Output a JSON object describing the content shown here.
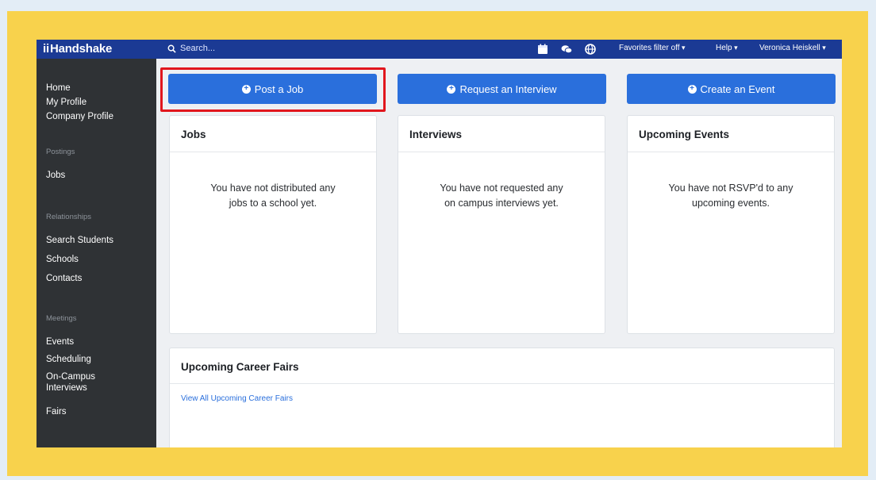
{
  "app": {
    "logo_mark": "ii",
    "logo_text": "Handshake"
  },
  "topbar": {
    "search_placeholder": "Search...",
    "icons": [
      "calendar-icon",
      "chat-icon",
      "globe-icon"
    ],
    "favorites_filter": "Favorites filter off",
    "help": "Help",
    "user": "Veronica Heiskell"
  },
  "sidebar": {
    "items_top": [
      "Home",
      "My Profile",
      "Company Profile"
    ],
    "section_postings": "Postings",
    "item_jobs": "Jobs",
    "section_relationships": "Relationships",
    "relationships": [
      "Search Students",
      "Schools",
      "Contacts"
    ],
    "section_meetings": "Meetings",
    "meetings": [
      "Events",
      "Scheduling",
      "On-Campus Interviews",
      "Fairs"
    ]
  },
  "actions": {
    "post_job": "Post a Job",
    "request_interview": "Request an Interview",
    "create_event": "Create an Event"
  },
  "cards": {
    "jobs": {
      "title": "Jobs",
      "line1": "You have not distributed any",
      "line2": "jobs to a school yet."
    },
    "interviews": {
      "title": "Interviews",
      "line1": "You have not requested any",
      "line2": "on campus interviews yet."
    },
    "events": {
      "title": "Upcoming Events",
      "line1": "You have not RSVP'd to any",
      "line2": "upcoming events."
    }
  },
  "career_fairs": {
    "title": "Upcoming Career Fairs",
    "link": "View All Upcoming Career Fairs"
  },
  "colors": {
    "brand_navy": "#1b3a94",
    "button_blue": "#2a6fdc",
    "sidebar": "#2f3235",
    "highlight_red": "#e1161d",
    "frame_yellow": "#f8d24c"
  }
}
